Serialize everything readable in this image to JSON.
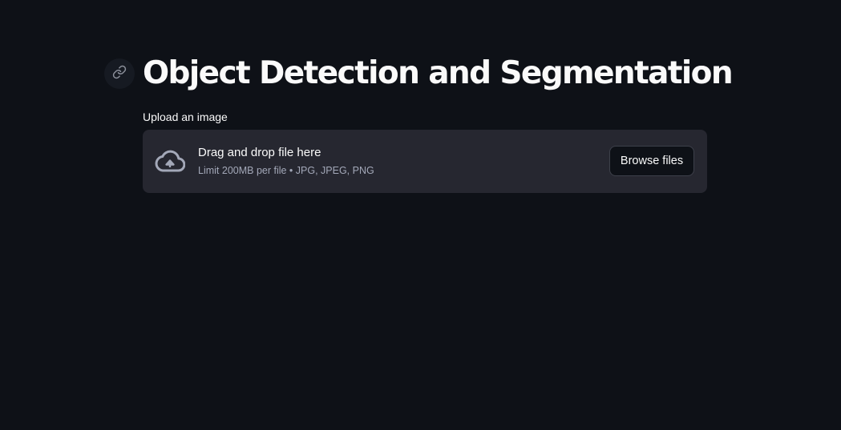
{
  "header": {
    "title": "Object Detection and Segmentation",
    "anchor_icon": "link-icon"
  },
  "uploader": {
    "label": "Upload an image",
    "icon": "cloud-upload-icon",
    "drop_title": "Drag and drop file here",
    "drop_limit": "Limit 200MB per file • JPG, JPEG, PNG",
    "browse_label": "Browse files"
  },
  "colors": {
    "background": "#0e1117",
    "dropzone": "#262730",
    "text": "#fafafa",
    "muted": "#a3a8b8"
  }
}
